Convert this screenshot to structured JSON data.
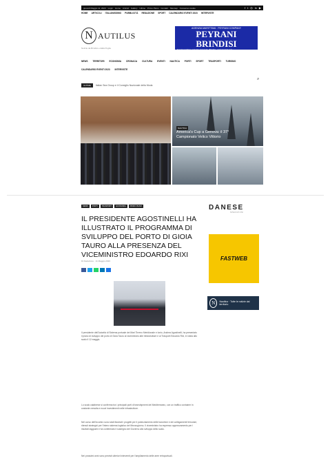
{
  "topbar": {
    "date": "giovedì Maggio 11, 2023",
    "links": [
      "Login",
      "Home",
      "Articoli",
      "Gallery",
      "Ultime",
      "Primo Piano",
      "Contatti",
      "Sitemap",
      "Consenso cookie"
    ],
    "social": [
      "f",
      "t",
      "◎",
      "in",
      "▶"
    ]
  },
  "nav1": [
    "HOME",
    "ARTICOLI",
    "ITALIANISSIMO",
    "PUBBLICITÀ",
    "REDAZIONE",
    "SPORT",
    "CALENDARIO EVENTI 2023",
    "INTERVISTE"
  ],
  "logo": {
    "letter": "N",
    "name": "AUTILUS",
    "tagline": "Notizie da Brindisi e dalla Puglia"
  },
  "ad_peyrani": {
    "top": "AGENZIA MARITTIMA · PEYRANI COMPANY",
    "big": "PEYRANI BRINDISI",
    "small": "Servizi marittimi, portuali e doganali · Brindisi · www.peyrani.com"
  },
  "nav2": [
    "NEWS",
    "TERRITORI",
    "ECONOMIA",
    "CRONACA",
    "CULTURA",
    "EVENTI",
    "NAUTICA",
    "PORTI",
    "SPORT",
    "TRASPORTI",
    "TURISMO",
    "CALENDARIO EVENTI 2023",
    "INTERVISTE"
  ],
  "ticker": {
    "badge": "ULTIME",
    "text": "Italian Sea Group e il Consiglio Nazionale della Moda"
  },
  "hero_right": {
    "category": "NAUTICA",
    "title": "America's Cup a Genova: il 37° Campionato Velico Vittorio"
  },
  "article": {
    "categories": [
      "NEWS",
      "PORTI",
      "TRASPORTI",
      "ECONOMIA",
      "PRIMO PIANO"
    ],
    "title": "Il presidente Agostinelli ha illustrato il programma di sviluppo del porto di Gioia Tauro alla presenza del viceministro Edoardo Rixi",
    "byline": "Di Redazione · 11 Maggio 2023",
    "share_colors": [
      "#3b5998",
      "#1da1f2",
      "#25d366",
      "#0077b5",
      "#1a73e8"
    ],
    "paragraphs": [
      "Il presidente dell'Autorità di Sistema portuale dei Mari Tirreno Meridionale e Ionio, Andrea Agostinelli, ha presentato il piano di sviluppo del porto di Gioia Tauro al viceministro alle Infrastrutture e ai Trasporti Edoardo Rixi, in visita allo scalo il 12 maggio.",
      "Lo scalo calabrese si conferma tra i principali porti di transhipment del Mediterraneo, con un traffico container in costante crescita e nuovi investimenti nelle infrastrutture.",
      "Nel corso dell'incontro sono stati illustrati i progetti per il potenziamento delle banchine e dei collegamenti ferroviari, ritenuti strategici per l'intero sistema logistico del Mezzogiorno. Il viceministro ha espresso apprezzamento per i risultati raggiunti e ha confermato il sostegno del Governo allo sviluppo dello scalo.",
      "Nei prossimi anni sono previsti ulteriori interventi per l'ampliamento delle aree retroportuali."
    ]
  },
  "sidebar": {
    "logo": "DANESE",
    "logo_sub": "SPEDIZIONI",
    "fastweb": "FASTWEB",
    "banner": "Nautilus · Tutte le notizie dal territorio"
  }
}
